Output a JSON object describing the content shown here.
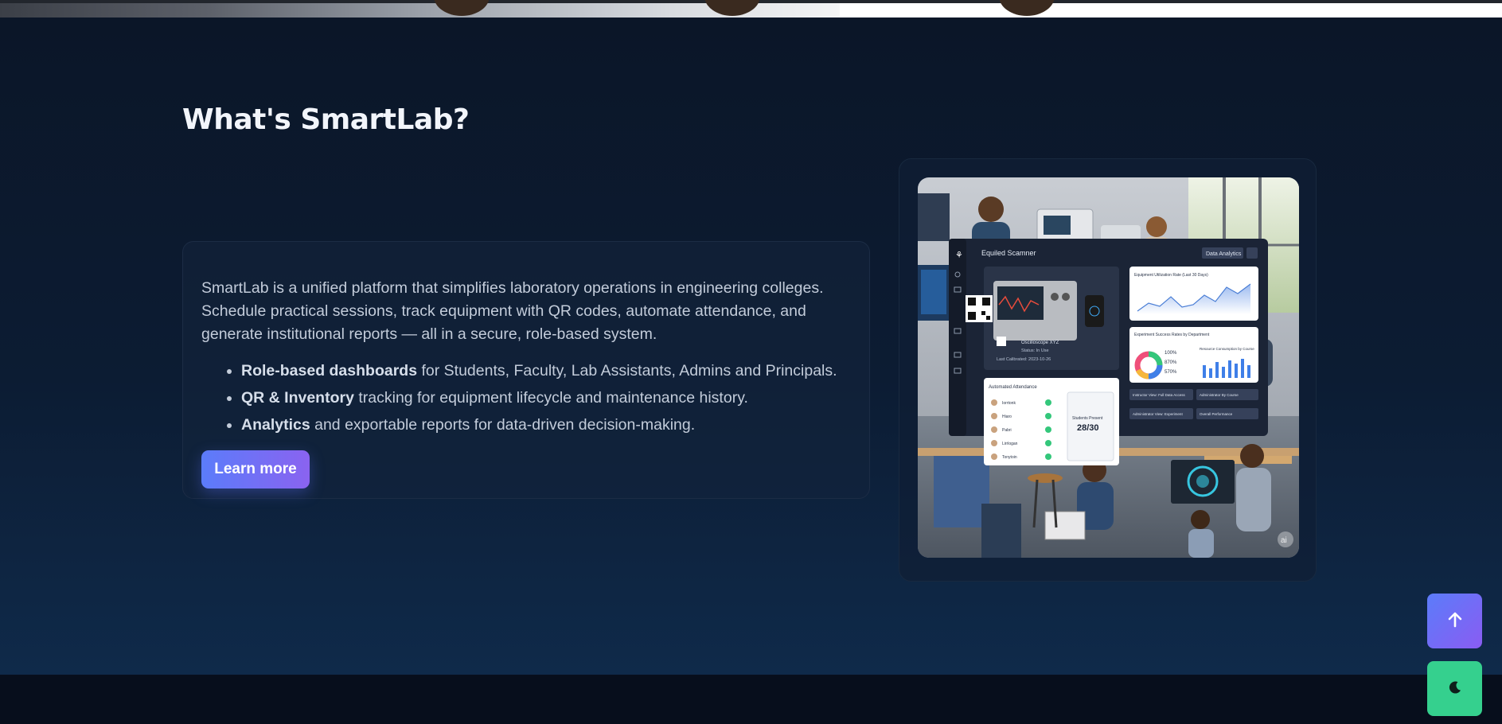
{
  "section": {
    "title": "What's SmartLab?",
    "description": "SmartLab is a unified platform that simplifies laboratory operations in engineering colleges. Schedule practical sessions, track equipment with QR codes, automate attendance, and generate institutional reports — all in a secure, role-based system.",
    "features": [
      {
        "bold": "Role-based dashboards",
        "text": " for Students, Faculty, Lab Assistants, Admins and Principals."
      },
      {
        "bold": "QR & Inventory",
        "text": " tracking for equipment lifecycle and maintenance history."
      },
      {
        "bold": "Analytics",
        "text": " and exportable reports for data-driven decision-making."
      }
    ],
    "cta_label": "Learn more"
  },
  "illustration": {
    "app_name": "Equiled Scamner",
    "header_button": "Data Analytics",
    "equipment_name": "Oscilloscope XYZ",
    "equipment_status": "Status: In Use",
    "equipment_calibrated": "Last Calibrated: 2023-10-26",
    "chart1_title": "Equipment Utilization Rate (Last 30 Days)",
    "chart2_title": "Experiment Success Rates by Department",
    "chart3_title": "Resource Consumption by Course",
    "donut_values": [
      "100%",
      "870%",
      "570%"
    ],
    "attendance_title": "Automated Attendance",
    "attendance_names": [
      "Iorrtonk",
      "Hiaro",
      "Pabri",
      "Lirrlogan",
      "Tonytoin"
    ],
    "students_present_label": "Students Present",
    "students_present_value": "28/30",
    "action_buttons": [
      "Instructor View: Full Data Access",
      "Administrator By Course",
      "Administrator View: Experiment",
      "Overall Performance"
    ],
    "watermark": "ai"
  },
  "colors": {
    "accent_gradient_start": "#5b7cfa",
    "accent_gradient_end": "#8a63f0",
    "moon_button": "#35d08e",
    "background": "#0b1628"
  },
  "icons": {
    "scroll_top": "arrow-up-icon",
    "theme_toggle": "moon-icon"
  }
}
